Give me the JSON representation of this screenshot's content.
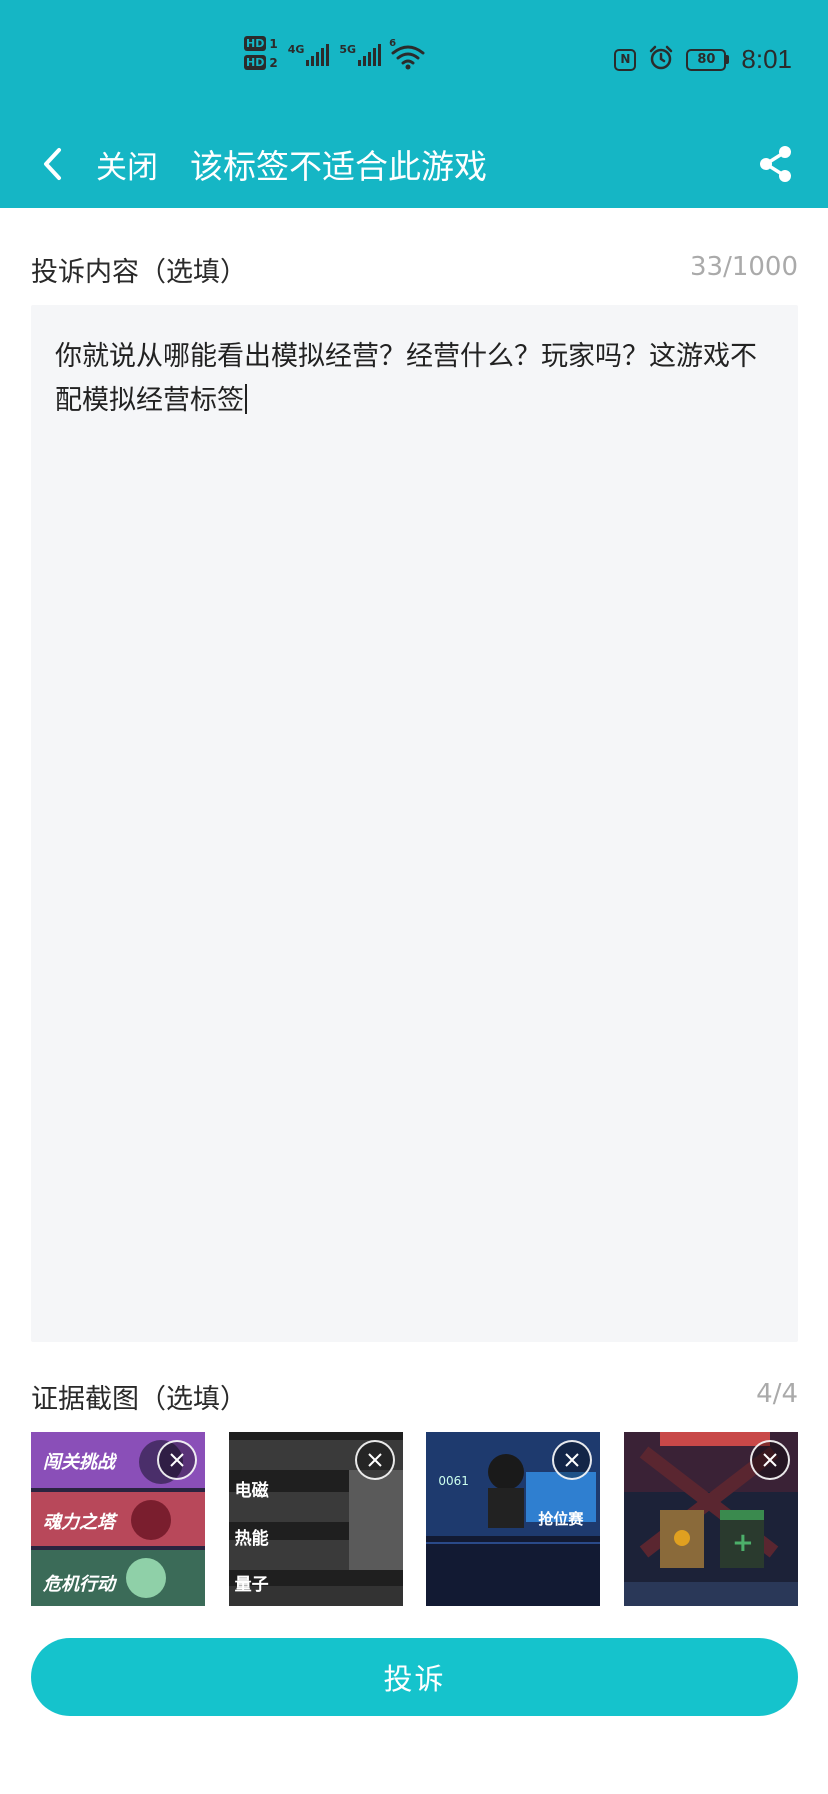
{
  "status_bar": {
    "sim1_label": "HD",
    "sim1_num": "1",
    "sim2_label": "HD",
    "sim2_num": "2",
    "net1": "4G",
    "net2": "5G",
    "wifi_label": "6",
    "nfc_label": "N",
    "battery": "80",
    "time": "8:01"
  },
  "navbar": {
    "close_label": "关闭",
    "title": "该标签不适合此游戏"
  },
  "complaint": {
    "label": "投诉内容（选填）",
    "counter": "33/1000",
    "text": "你就说从哪能看出模拟经营？经营什么？玩家吗？这游戏不配模拟经营标签"
  },
  "evidence": {
    "label": "证据截图（选填）",
    "counter": "4/4",
    "thumbs": [
      {
        "lines": [
          "闯关挑战",
          "魂力之塔",
          "危机行动"
        ]
      },
      {
        "lines": [
          "电磁",
          "热能",
          "量子"
        ]
      },
      {
        "lines": [
          "抢位赛",
          "0061"
        ]
      },
      {
        "lines": [
          "+"
        ]
      }
    ]
  },
  "submit_label": "投诉",
  "colors": {
    "header": "#15b6c5",
    "button": "#15c3cc",
    "input_bg": "#f5f6f8"
  }
}
